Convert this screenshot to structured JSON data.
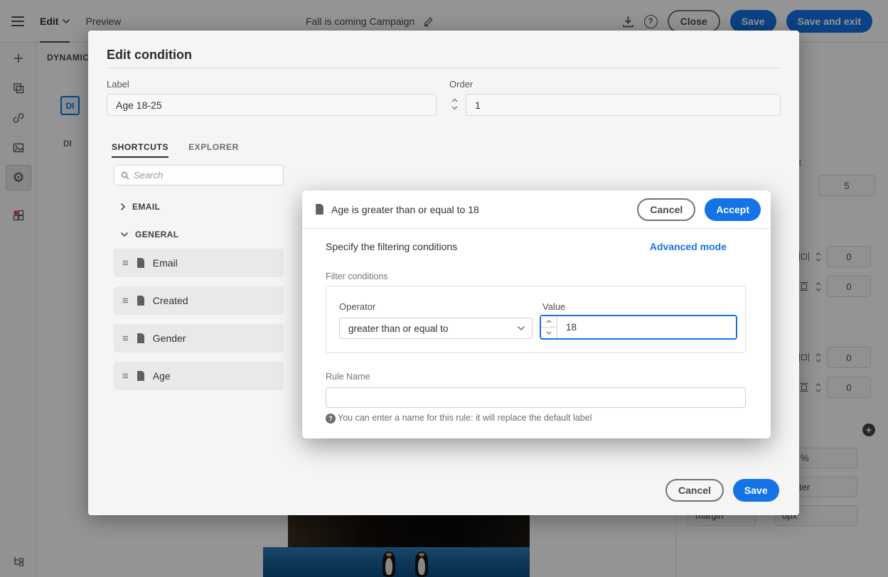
{
  "topbar": {
    "edit": "Edit",
    "preview": "Preview",
    "title": "Fall is coming Campaign",
    "close": "Close",
    "save": "Save",
    "save_and_exit": "Save and exit"
  },
  "canvas": {
    "dynamic_label": "DYNAMIC",
    "di_badge": "DI",
    "di_badge_2": "DI"
  },
  "right_panel": {
    "height_label_fragment": "ht",
    "height_value": "5",
    "spacing_values": [
      "0",
      "0",
      "0",
      "0"
    ],
    "percent_value": "%",
    "align_fragment": "ter",
    "margin_label": "margin",
    "margin_value": "0px"
  },
  "edit_condition": {
    "title": "Edit condition",
    "label_field_label": "Label",
    "label_field_value": "Age 18-25",
    "order_field_label": "Order",
    "order_field_value": "1",
    "tabs": [
      {
        "label": "SHORTCUTS"
      },
      {
        "label": "EXPLORER"
      }
    ],
    "search_placeholder": "Search",
    "sections": [
      {
        "label": "EMAIL"
      },
      {
        "label": "GENERAL"
      }
    ],
    "general_items": [
      "Email",
      "Created",
      "Gender",
      "Age"
    ],
    "cancel": "Cancel",
    "save": "Save"
  },
  "rule_editor": {
    "title": "Age is greater than or equal to 18",
    "cancel": "Cancel",
    "accept": "Accept",
    "subtitle": "Specify the filtering conditions",
    "advanced_mode": "Advanced mode",
    "filter_conditions_label": "Filter conditions",
    "operator_label": "Operator",
    "operator_value": "greater than or equal to",
    "value_label": "Value",
    "value": "18",
    "rule_name_label": "Rule Name",
    "rule_name_value": "",
    "hint": "You can enter a name for this rule: it will replace the default label"
  },
  "icons": {
    "gear": "⚙",
    "drag": "≡",
    "plus": "+",
    "help": "?"
  },
  "colors": {
    "accent": "#1473E6"
  }
}
